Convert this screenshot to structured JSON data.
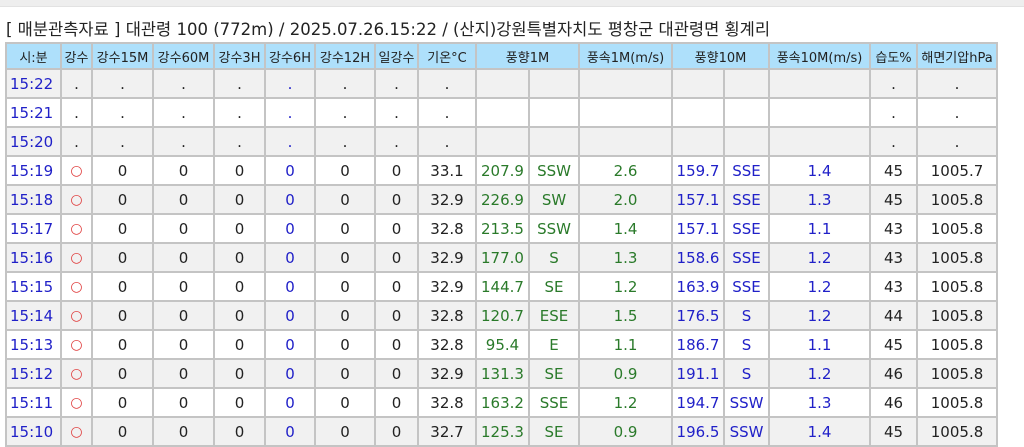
{
  "title": "[ 매분관측자료 ] 대관령 100 (772m) / 2025.07.26.15:22 / (산지)강원특별자치도 평창군 대관령면 횡계리",
  "headers": [
    "시:분",
    "강수",
    "강수15M",
    "강수60M",
    "강수3H",
    "강수6H",
    "강수12H",
    "일강수",
    "기온°C",
    "풍향1M",
    "풍속1M(m/s)",
    "풍향10M",
    "풍속10M(m/s)",
    "습도%",
    "해면기압hPa"
  ],
  "rows": [
    [
      "15:22",
      ".",
      ".",
      ".",
      ".",
      ".",
      ".",
      ".",
      ".",
      "",
      "",
      "",
      "",
      "",
      "",
      ".",
      "."
    ],
    [
      "15:21",
      ".",
      ".",
      ".",
      ".",
      ".",
      ".",
      ".",
      ".",
      "",
      "",
      "",
      "",
      "",
      "",
      ".",
      "."
    ],
    [
      "15:20",
      ".",
      ".",
      ".",
      ".",
      ".",
      ".",
      ".",
      ".",
      "",
      "",
      "",
      "",
      "",
      "",
      ".",
      "."
    ],
    [
      "15:19",
      "○",
      "0",
      "0",
      "0",
      "0",
      "0",
      "0",
      "33.1",
      "207.9",
      "SSW",
      "2.6",
      "159.7",
      "SSE",
      "1.4",
      "45",
      "1005.7"
    ],
    [
      "15:18",
      "○",
      "0",
      "0",
      "0",
      "0",
      "0",
      "0",
      "32.9",
      "226.9",
      "SW",
      "2.0",
      "157.1",
      "SSE",
      "1.3",
      "45",
      "1005.8"
    ],
    [
      "15:17",
      "○",
      "0",
      "0",
      "0",
      "0",
      "0",
      "0",
      "32.8",
      "213.5",
      "SSW",
      "1.4",
      "157.1",
      "SSE",
      "1.1",
      "43",
      "1005.8"
    ],
    [
      "15:16",
      "○",
      "0",
      "0",
      "0",
      "0",
      "0",
      "0",
      "32.9",
      "177.0",
      "S",
      "1.3",
      "158.6",
      "SSE",
      "1.2",
      "43",
      "1005.8"
    ],
    [
      "15:15",
      "○",
      "0",
      "0",
      "0",
      "0",
      "0",
      "0",
      "32.9",
      "144.7",
      "SE",
      "1.2",
      "163.9",
      "SSE",
      "1.2",
      "43",
      "1005.8"
    ],
    [
      "15:14",
      "○",
      "0",
      "0",
      "0",
      "0",
      "0",
      "0",
      "32.8",
      "120.7",
      "ESE",
      "1.5",
      "176.5",
      "S",
      "1.2",
      "44",
      "1005.8"
    ],
    [
      "15:13",
      "○",
      "0",
      "0",
      "0",
      "0",
      "0",
      "0",
      "32.8",
      "95.4",
      "E",
      "1.1",
      "186.7",
      "S",
      "1.1",
      "45",
      "1005.8"
    ],
    [
      "15:12",
      "○",
      "0",
      "0",
      "0",
      "0",
      "0",
      "0",
      "32.9",
      "131.3",
      "SE",
      "0.9",
      "191.1",
      "S",
      "1.2",
      "46",
      "1005.8"
    ],
    [
      "15:11",
      "○",
      "0",
      "0",
      "0",
      "0",
      "0",
      "0",
      "32.8",
      "163.2",
      "SSE",
      "1.2",
      "194.7",
      "SSW",
      "1.3",
      "46",
      "1005.8"
    ],
    [
      "15:10",
      "○",
      "0",
      "0",
      "0",
      "0",
      "0",
      "0",
      "32.7",
      "125.3",
      "SE",
      "0.9",
      "196.5",
      "SSW",
      "1.4",
      "45",
      "1005.8"
    ]
  ]
}
